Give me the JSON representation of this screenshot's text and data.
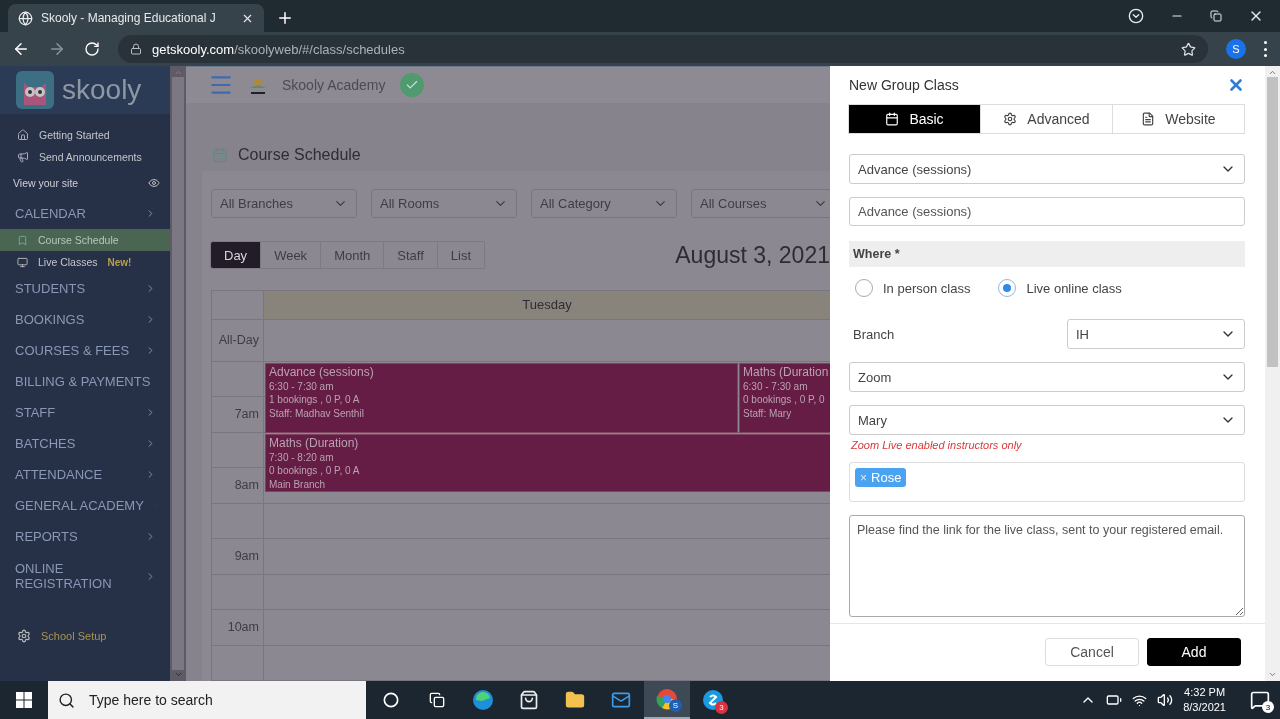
{
  "browser": {
    "tab_title": "Skooly - Managing Educational J",
    "url_host": "getskooly.com",
    "url_path": "/skoolyweb/#/class/schedules",
    "profile_initial": "S"
  },
  "sidebar": {
    "brand": "skooly",
    "items": [
      {
        "kind": "link",
        "label": "Getting Started"
      },
      {
        "kind": "link",
        "label": "Send Announcements"
      },
      {
        "kind": "site",
        "label": "View your site"
      },
      {
        "kind": "section",
        "label": "CALENDAR"
      },
      {
        "kind": "sub",
        "label": "Course Schedule",
        "selected": true
      },
      {
        "kind": "sub",
        "label": "Live Classes",
        "badge": "New!",
        "selected": false
      },
      {
        "kind": "section",
        "label": "STUDENTS"
      },
      {
        "kind": "section",
        "label": "BOOKINGS"
      },
      {
        "kind": "section",
        "label": "COURSES & FEES"
      },
      {
        "kind": "section",
        "label": "BILLING & PAYMENTS"
      },
      {
        "kind": "section",
        "label": "STAFF"
      },
      {
        "kind": "section",
        "label": "BATCHES"
      },
      {
        "kind": "section",
        "label": "ATTENDANCE"
      },
      {
        "kind": "section",
        "label": "GENERAL ACADEMY"
      },
      {
        "kind": "section",
        "label": "REPORTS"
      },
      {
        "kind": "section",
        "label": "ONLINE REGISTRATION"
      },
      {
        "kind": "setup",
        "label": "School Setup"
      }
    ]
  },
  "header": {
    "academy": "Skooly Academy"
  },
  "page_title": "Course Schedule",
  "filters": [
    "All Branches",
    "All Rooms",
    "All Category",
    "All Courses"
  ],
  "views": [
    {
      "label": "Day",
      "selected": true
    },
    {
      "label": "Week",
      "selected": false
    },
    {
      "label": "Month",
      "selected": false
    },
    {
      "label": "Staff",
      "selected": false
    },
    {
      "label": "List",
      "selected": false
    }
  ],
  "date": "August 3, 2021",
  "calendar": {
    "day": "Tuesday",
    "all_day": "All-Day",
    "times": [
      "7am",
      "8am",
      "9am",
      "10am"
    ],
    "events": [
      {
        "title": "Advance (sessions)",
        "lines": [
          "6:30 - 7:30 am",
          "1 bookings , 0 P, 0 A",
          "Staff: Madhav Senthil"
        ]
      },
      {
        "title": "Maths (Duration",
        "lines": [
          "6:30 - 7:30 am",
          "0 bookings , 0 P, 0",
          "Staff: Mary"
        ]
      },
      {
        "title": "Maths (Duration)",
        "lines": [
          "7:30 - 8:20 am",
          "0 bookings , 0 P, 0 A",
          "Main Branch"
        ]
      }
    ]
  },
  "modal": {
    "title": "New Group Class",
    "tabs": [
      {
        "label": "Basic",
        "selected": true
      },
      {
        "label": "Advanced",
        "selected": false
      },
      {
        "label": "Website",
        "selected": false
      }
    ],
    "course_select": "Advance (sessions)",
    "name_input": "Advance (sessions)",
    "where_label": "Where *",
    "where_options": [
      {
        "label": "In person class",
        "selected": false
      },
      {
        "label": "Live online class",
        "selected": true
      }
    ],
    "branch_label": "Branch",
    "branch_select": "IH",
    "platform_select": "Zoom",
    "instructor_select": "Mary",
    "instructor_hint": "Zoom Live enabled instructors only",
    "tags": [
      {
        "label": "Rose",
        "remove": "×"
      }
    ],
    "message": "Please find the link for the live class, sent to your registered email.",
    "buttons": [
      "Cancel",
      "Add"
    ]
  },
  "taskbar": {
    "search_placeholder": "Type here to search",
    "chrome_badge": "S",
    "chat_badge": "3",
    "time": "4:32 PM",
    "date": "8/3/2021",
    "notifications": "3"
  }
}
